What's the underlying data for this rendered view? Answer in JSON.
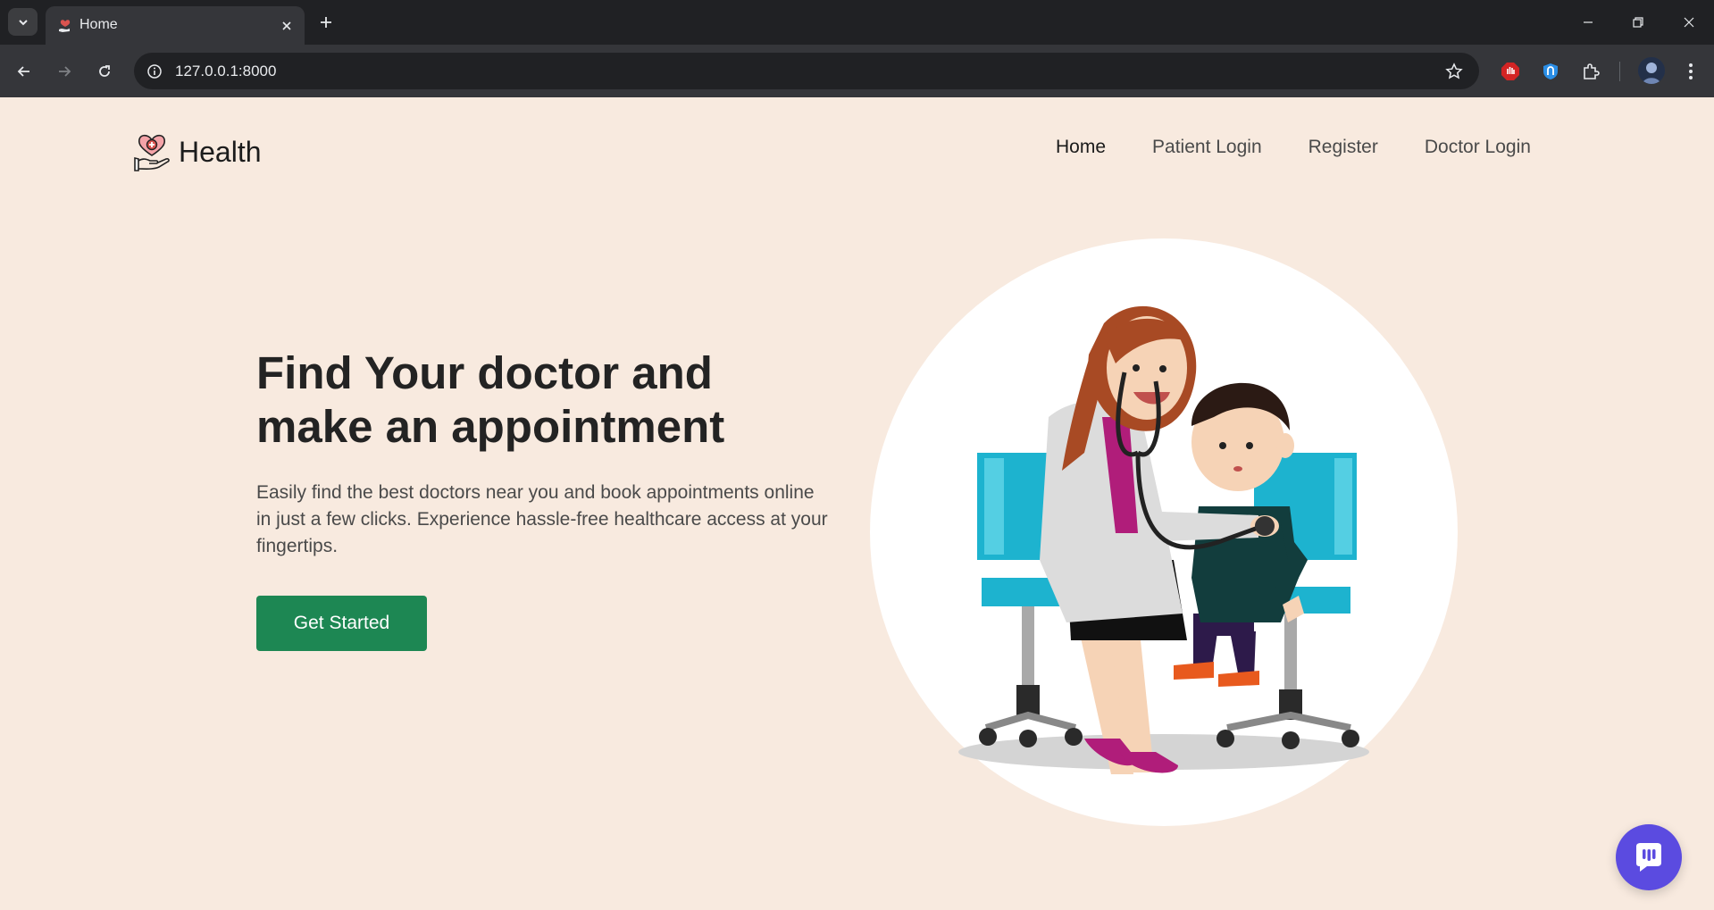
{
  "browser": {
    "tab": {
      "title": "Home"
    },
    "url": "127.0.0.1:8000"
  },
  "header": {
    "brand": "Health",
    "nav": [
      {
        "label": "Home",
        "active": true
      },
      {
        "label": "Patient Login",
        "active": false
      },
      {
        "label": "Register",
        "active": false
      },
      {
        "label": "Doctor Login",
        "active": false
      }
    ]
  },
  "hero": {
    "title_line1": "Find Your doctor and",
    "title_line2": "make an appointment",
    "description": "Easily find the best doctors near you and book appointments online in just a few clicks. Experience hassle-free healthcare access at your fingertips.",
    "cta_label": "Get Started"
  },
  "colors": {
    "page_bg": "#f8eadf",
    "cta": "#1d8753",
    "chat_button": "#5b4be0"
  },
  "icons": {
    "tab_list": "chevron-down-icon",
    "close": "close-icon",
    "new_tab": "plus-icon",
    "back": "arrow-left-icon",
    "forward": "arrow-right-icon",
    "reload": "reload-icon",
    "site_info": "info-icon",
    "bookmark": "star-icon",
    "extensions": "puzzle-icon",
    "menu": "more-vertical-icon",
    "chat": "chat-icon"
  }
}
